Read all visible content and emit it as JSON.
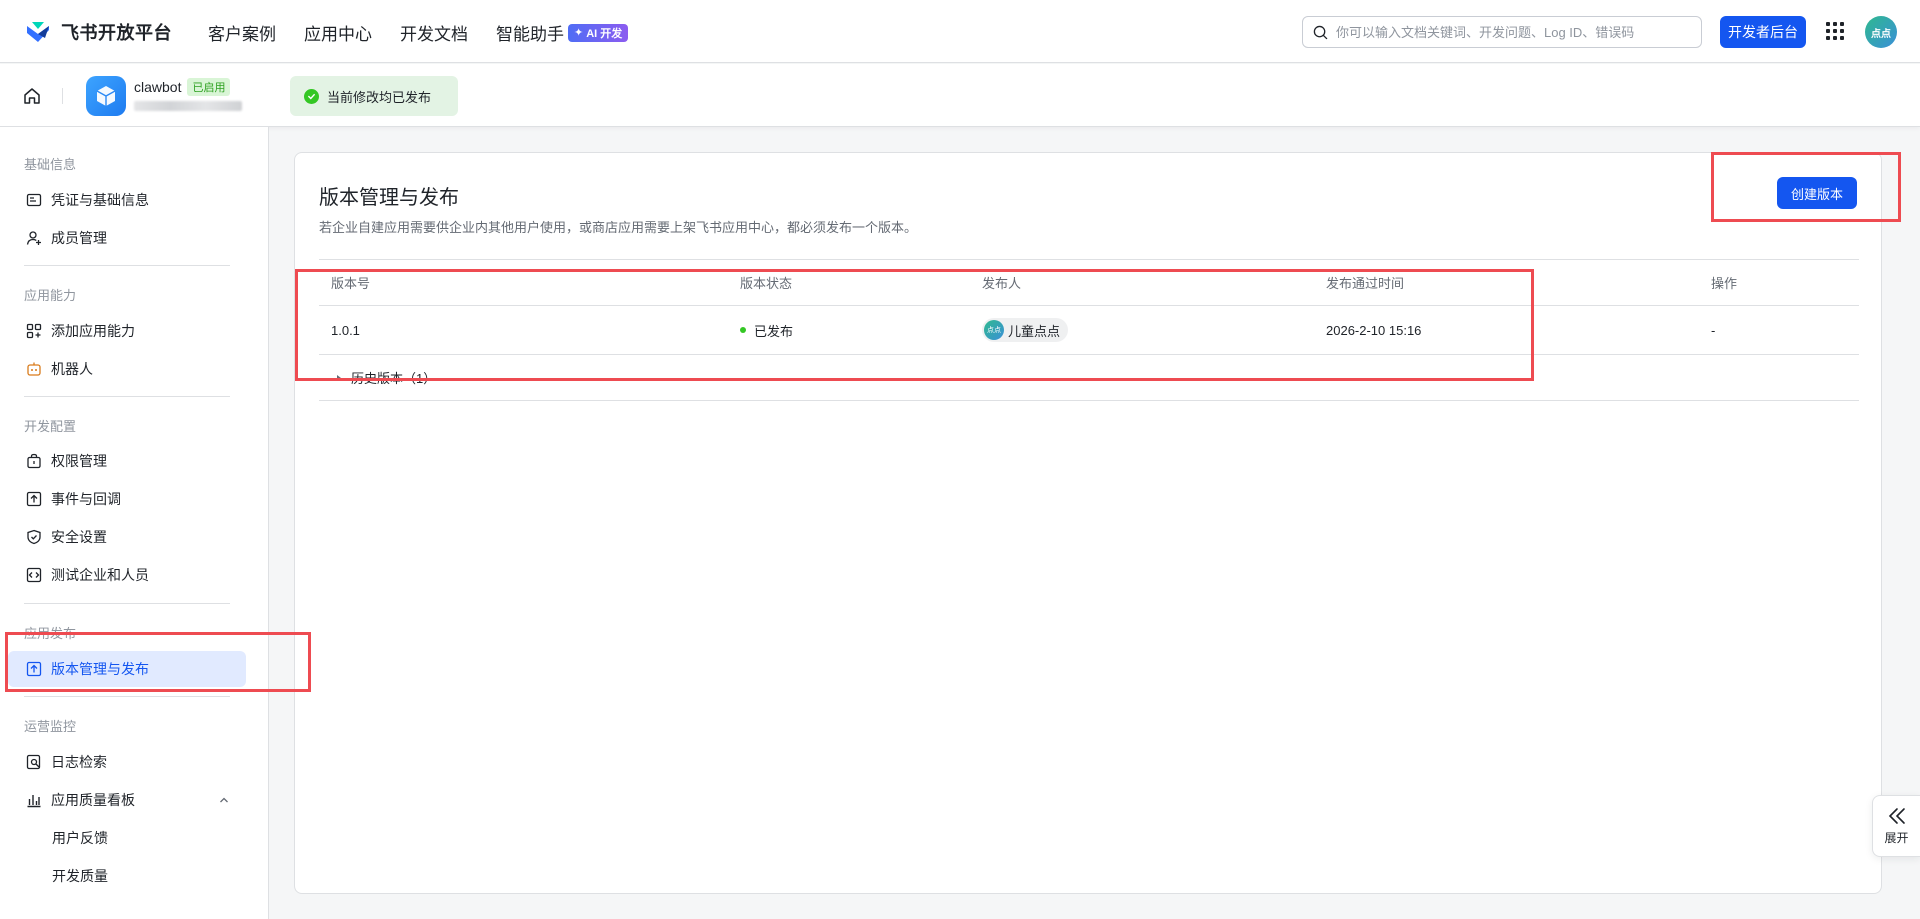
{
  "brand": {
    "name": "飞书开放平台"
  },
  "topnav": [
    {
      "label": "客户案例"
    },
    {
      "label": "应用中心"
    },
    {
      "label": "开发文档"
    },
    {
      "label": "智能助手",
      "badge": "AI 开发"
    }
  ],
  "search": {
    "placeholder": "你可以输入文档关键词、开发问题、Log ID、错误码"
  },
  "header": {
    "console_button": "开发者后台",
    "avatar_text": "点点"
  },
  "app": {
    "name": "clawbot",
    "status": "已启用",
    "save_status": "当前修改均已发布"
  },
  "sidebar": {
    "groups": [
      {
        "title": "基础信息",
        "items": [
          {
            "label": "凭证与基础信息",
            "icon": "id-card-icon"
          },
          {
            "label": "成员管理",
            "icon": "user-add-icon"
          }
        ]
      },
      {
        "title": "应用能力",
        "items": [
          {
            "label": "添加应用能力",
            "icon": "apps-add-icon"
          },
          {
            "label": "机器人",
            "icon": "robot-icon"
          }
        ]
      },
      {
        "title": "开发配置",
        "items": [
          {
            "label": "权限管理",
            "icon": "lock-bag-icon"
          },
          {
            "label": "事件与回调",
            "icon": "event-icon"
          },
          {
            "label": "安全设置",
            "icon": "shield-icon"
          },
          {
            "label": "测试企业和人员",
            "icon": "code-icon"
          }
        ]
      },
      {
        "title": "应用发布",
        "items": [
          {
            "label": "版本管理与发布",
            "icon": "upload-icon",
            "active": true
          }
        ]
      },
      {
        "title": "运营监控",
        "items": [
          {
            "label": "日志检索",
            "icon": "log-search-icon"
          },
          {
            "label": "应用质量看板",
            "icon": "bar-chart-icon",
            "expanded": true
          },
          {
            "label": "用户反馈"
          },
          {
            "label": "开发质量"
          }
        ]
      }
    ]
  },
  "main": {
    "title": "版本管理与发布",
    "description": "若企业自建应用需要供企业内其他用户使用，或商店应用需要上架飞书应用中心，都必须发布一个版本。",
    "create_button": "创建版本",
    "table": {
      "headers": [
        "版本号",
        "版本状态",
        "发布人",
        "发布通过时间",
        "操作"
      ],
      "rows": [
        {
          "version": "1.0.1",
          "status": "已发布",
          "publisher": "儿童点点",
          "publisher_avatar": "点点",
          "time": "2026-2-10 15:16",
          "action": "-"
        }
      ],
      "history_label": "历史版本（1）"
    }
  },
  "expand_tab": {
    "label": "展开"
  },
  "colors": {
    "primary": "#1456f0",
    "success": "#34c724",
    "annotation": "#ee4b51",
    "active_bg": "#e1eaff"
  }
}
